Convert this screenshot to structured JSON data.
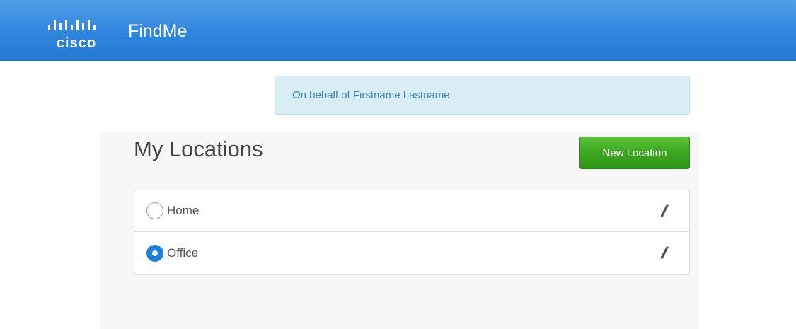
{
  "header": {
    "logo_text": "cisco",
    "logo_icon": "cisco-logo-icon",
    "app_title": "FindMe"
  },
  "notice": {
    "text": "On behalf of Firstname Lastname"
  },
  "locations": {
    "title": "My Locations",
    "new_button_label": "New Location",
    "items": [
      {
        "label": "Home",
        "selected": false,
        "edit_icon": "pencil-icon"
      },
      {
        "label": "Office",
        "selected": true,
        "edit_icon": "pencil-icon"
      }
    ]
  },
  "colors": {
    "header_blue": "#2f86dd",
    "notice_bg": "#d9edf7",
    "notice_text": "#3a87ad",
    "button_green": "#3aa81e",
    "radio_selected": "#1e7fd6"
  }
}
